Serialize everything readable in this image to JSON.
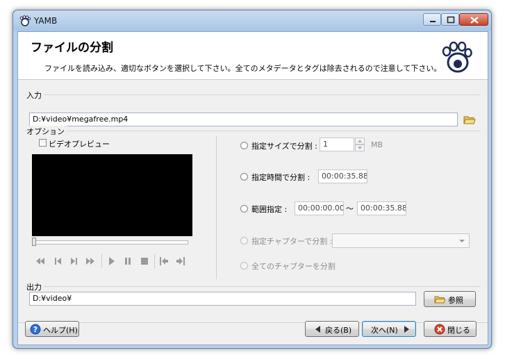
{
  "window": {
    "title": "YAMB"
  },
  "header": {
    "title": "ファイルの分割",
    "description": "ファイルを読み込み、適切なボタンを選択して下さい。全てのメタデータとタグは除去されるので注意して下さい。"
  },
  "input": {
    "label": "入力",
    "path": "D:¥video¥megafree.mp4"
  },
  "options": {
    "label": "オプション",
    "video_preview_label": "ビデオプレビュー",
    "split_by_size": {
      "label": "指定サイズで分割 :",
      "value": "1",
      "unit": "MB"
    },
    "split_by_time": {
      "label": "指定時間で分割 :",
      "value": "00:00:35.880"
    },
    "range": {
      "label": "範囲指定 :",
      "start": "00:00:00.000",
      "sep": "～",
      "end": "00:00:35.880"
    },
    "split_by_chapter": {
      "label": "指定チャプターで分割 :",
      "value": ""
    },
    "split_all_chapters": {
      "label": "全てのチャプターを分割"
    }
  },
  "output": {
    "label": "出力",
    "path": "D:¥video¥",
    "browse_label": "参照"
  },
  "footer": {
    "help_label": "ヘルプ(H)",
    "back_label": "戻る(B)",
    "next_label": "次へ(N)",
    "close_label": "閉じる"
  },
  "colors": {
    "accent": "#3c7fb1",
    "window_frame": "#b9d1ea",
    "close_button": "#c7452c"
  }
}
